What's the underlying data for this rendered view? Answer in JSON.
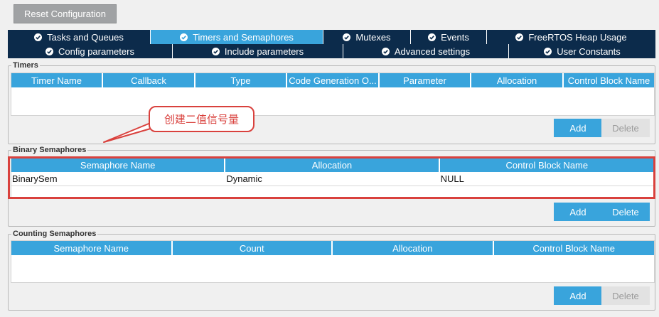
{
  "reset_label": "Reset Configuration",
  "tabs_row1": [
    {
      "label": "Tasks and Queues",
      "active": false
    },
    {
      "label": "Timers and Semaphores",
      "active": true
    },
    {
      "label": "Mutexes",
      "active": false
    },
    {
      "label": "Events",
      "active": false
    },
    {
      "label": "FreeRTOS Heap Usage",
      "active": false
    }
  ],
  "tabs_row2": [
    {
      "label": "Config parameters"
    },
    {
      "label": "Include parameters"
    },
    {
      "label": "Advanced settings"
    },
    {
      "label": "User Constants"
    }
  ],
  "timers": {
    "title": "Timers",
    "columns": [
      "Timer Name",
      "Callback",
      "Type",
      "Code Generation O...",
      "Parameter",
      "Allocation",
      "Control Block Name"
    ],
    "add_label": "Add",
    "delete_label": "Delete"
  },
  "binary": {
    "title": "Binary Semaphores",
    "columns": [
      "Semaphore Name",
      "Allocation",
      "Control Block Name"
    ],
    "rows": [
      [
        "BinarySem",
        "Dynamic",
        "NULL"
      ]
    ],
    "add_label": "Add",
    "delete_label": "Delete"
  },
  "counting": {
    "title": "Counting Semaphores",
    "columns": [
      "Semaphore Name",
      "Count",
      "Allocation",
      "Control Block Name"
    ],
    "add_label": "Add",
    "delete_label": "Delete"
  },
  "annotation": {
    "callout_text": "创建二值信号量",
    "color": "#d9413d"
  },
  "colors": {
    "tab_dark": "#0c2b4b",
    "accent": "#39a4dc",
    "disabled": "#e2e2e2"
  }
}
